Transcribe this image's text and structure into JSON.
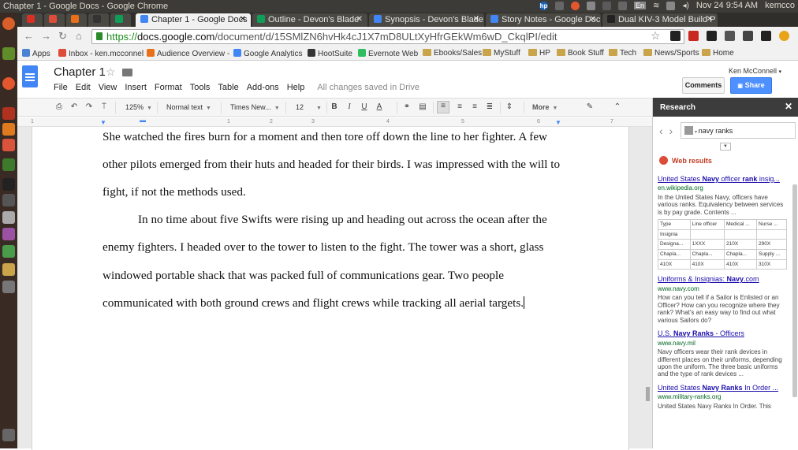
{
  "os": {
    "window_title": "Chapter 1 - Google Docs - Google Chrome",
    "indicator_en": "En",
    "datetime": "Nov 24  9:54 AM",
    "user": "kemcco"
  },
  "tabs": [
    {
      "label": "",
      "color": "#d93025"
    },
    {
      "label": "",
      "color": "#dd4b39"
    },
    {
      "label": "",
      "color": "#e8701a"
    },
    {
      "label": "",
      "color": "#333333"
    },
    {
      "label": "",
      "color": "#0f9d58"
    },
    {
      "label": "Chapter 1 - Google Docs",
      "color": "#4285f4",
      "active": true
    },
    {
      "label": "Outline - Devon's Blade",
      "color": "#0f9d58"
    },
    {
      "label": "Synopsis - Devon's Blade",
      "color": "#4285f4"
    },
    {
      "label": "Story Notes - Google Doc",
      "color": "#4285f4"
    },
    {
      "label": "Dual KIV-3 Model Build P",
      "color": "#222222"
    }
  ],
  "address": {
    "scheme": "https://",
    "domain": "docs.google.com",
    "path": "/document/d/15SMlZN6hvHk4cJ1X7mD8ULtXyHfrGEkWm6wD_CkqlPI/edit"
  },
  "bookmarks": [
    {
      "label": "Apps",
      "type": "apps"
    },
    {
      "label": "Inbox - ken.mcconnel",
      "type": "fav",
      "color": "#dd4b39"
    },
    {
      "label": "Audience Overview -",
      "type": "fav",
      "color": "#e8701a"
    },
    {
      "label": "Google Analytics",
      "type": "fav",
      "color": "#4285f4"
    },
    {
      "label": "HootSuite",
      "type": "fav",
      "color": "#333333"
    },
    {
      "label": "Evernote Web",
      "type": "fav",
      "color": "#2dbe60"
    },
    {
      "label": "Ebooks/Sales",
      "type": "folder"
    },
    {
      "label": "MyStuff",
      "type": "folder"
    },
    {
      "label": "HP",
      "type": "folder"
    },
    {
      "label": "Book Stuff",
      "type": "folder"
    },
    {
      "label": "Tech",
      "type": "folder"
    },
    {
      "label": "News/Sports",
      "type": "folder"
    },
    {
      "label": "Home",
      "type": "folder"
    }
  ],
  "doc": {
    "title": "Chapter 1",
    "menu": [
      "File",
      "Edit",
      "View",
      "Insert",
      "Format",
      "Tools",
      "Table",
      "Add-ons",
      "Help"
    ],
    "save_status": "All changes saved in Drive",
    "user": "Ken McConnell",
    "comments": "Comments",
    "share": "Share"
  },
  "format": {
    "zoom": "125%",
    "style": "Normal text",
    "font": "Times New...",
    "size": "12",
    "more": "More"
  },
  "ruler": [
    "1",
    "1",
    "2",
    "3",
    "4",
    "5",
    "6",
    "7"
  ],
  "body": [
    "She watched the fires burn for a moment and then tore off down the line to her fighter. A few",
    "other pilots emerged from their huts and headed for their birds. I was impressed with the will to",
    "fight, if not the methods used.",
    "In no time about five Swifts were rising up and heading out across the ocean after the",
    "enemy fighters. I headed over to the tower to listen to the fight.  The tower was a short, glass",
    "windowed portable shack that was packed full of communications gear. Two people",
    "communicated with both ground crews and flight crews while tracking all aerial targets."
  ],
  "research": {
    "title": "Research",
    "query": "navy ranks",
    "section": "Web results",
    "results": [
      {
        "title_parts": [
          "United States ",
          "Navy",
          " officer ",
          "rank",
          " insig..."
        ],
        "url": "en.wikipedia.org",
        "snippet": "In the United States Navy, officers have various ranks. Equivalency between services is by pay grade. Contents ...",
        "table": [
          [
            "Type",
            "Line officer",
            "Medical ...",
            "Nurse ..."
          ],
          [
            "Insignia",
            "",
            "",
            ""
          ],
          [
            "Designa...",
            "1XXX",
            "210X",
            "290X"
          ],
          [
            "Chapla...",
            "Chapla...",
            "Chapla...",
            "Supply ..."
          ],
          [
            "410X",
            "410X",
            "410X",
            "310X"
          ]
        ]
      },
      {
        "title_parts": [
          "Uniforms & Insignias: ",
          "Navy",
          ".com"
        ],
        "url": "www.navy.com",
        "snippet": "How can you tell if a Sailor is Enlisted or an Officer? How can you recognize where they rank? What's an easy way to find out what various Sailors do?"
      },
      {
        "title_parts": [
          "U.S. ",
          "Navy Ranks",
          " - Officers"
        ],
        "url": "www.navy.mil",
        "snippet": "Navy officers wear their rank devices in different places on their uniforms, depending upon the uniform. The three basic uniforms and the type of rank devices ..."
      },
      {
        "title_parts": [
          "United States ",
          "Navy Ranks",
          " In Order ..."
        ],
        "url": "www.military-ranks.org",
        "snippet": "United States Navy Ranks In Order. This"
      }
    ]
  }
}
